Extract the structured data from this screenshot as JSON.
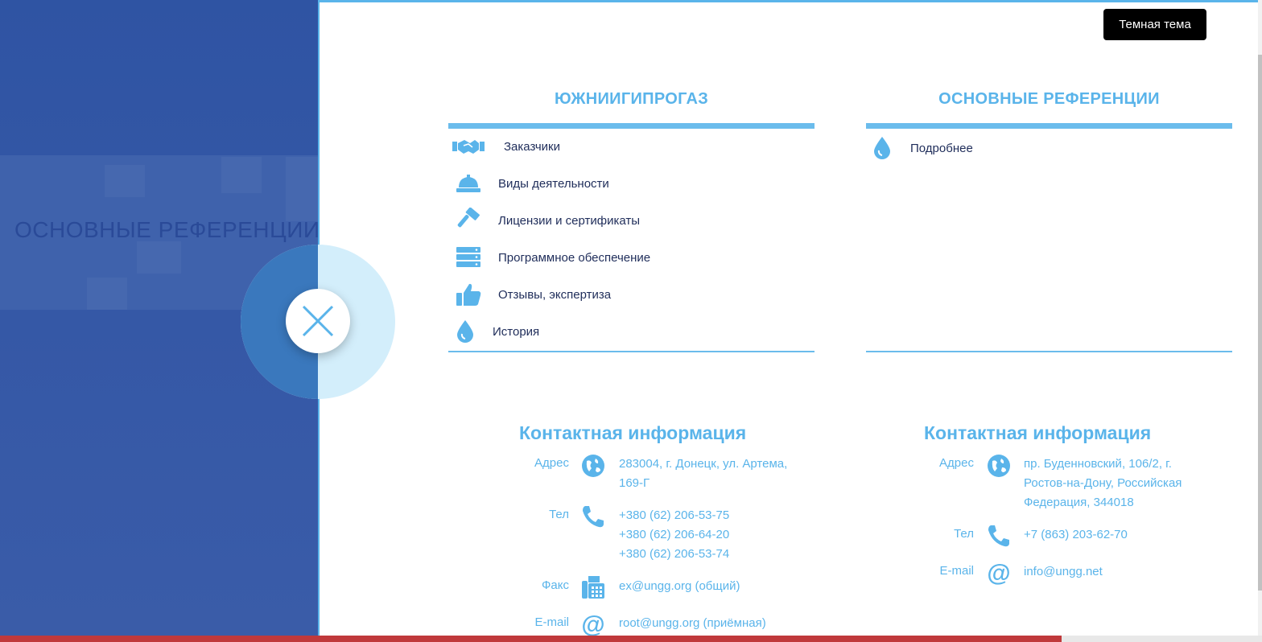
{
  "theme_button": "Темная тема",
  "left_panel": {
    "title": "ОСНОВНЫЕ РЕФЕРЕНЦИИ"
  },
  "menu_left": {
    "title": "ЮЖНИИГИПРОГАЗ",
    "items": [
      {
        "label": "Заказчики",
        "icon": "handshake-icon"
      },
      {
        "label": "Виды деятельности",
        "icon": "hardhat-icon"
      },
      {
        "label": "Лицензии и сертификаты",
        "icon": "gavel-icon"
      },
      {
        "label": "Программное обеспечение",
        "icon": "server-icon"
      },
      {
        "label": "Отзывы, экспертиза",
        "icon": "thumbs-up-icon"
      },
      {
        "label": "История",
        "icon": "drop-icon"
      }
    ]
  },
  "menu_right": {
    "title": "ОСНОВНЫЕ РЕФЕРЕНЦИИ",
    "items": [
      {
        "label": "Подробнее",
        "icon": "drop-icon"
      }
    ]
  },
  "contacts_left": {
    "title": "Контактная информация",
    "address_label": "Адрес",
    "address_lines": [
      "283004, г. Донецк, ул. Артема,",
      "169-Г"
    ],
    "phone_label": "Тел",
    "phones": [
      "+380 (62) 206-53-75",
      "+380 (62) 206-64-20",
      "+380 (62) 206-53-74"
    ],
    "fax_label": "Факс",
    "fax": "ex@ungg.org (общий)",
    "email_label": "E-mail",
    "email": "root@ungg.org (приёмная)"
  },
  "contacts_right": {
    "title": "Контактная информация",
    "address_label": "Адрес",
    "address_lines": [
      "пр. Буденновский, 106/2, г.",
      "Ростов-на-Дону, Российская",
      "Федерация, 344018"
    ],
    "phone_label": "Тел",
    "phones": [
      "+7 (863) 203-62-70"
    ],
    "email_label": "E-mail",
    "email": "info@ungg.net"
  },
  "colors": {
    "accent": "#5ab4ea",
    "panel": "#3457a6",
    "text": "#1f2d5a",
    "bottom_bar": "#c0393b"
  }
}
